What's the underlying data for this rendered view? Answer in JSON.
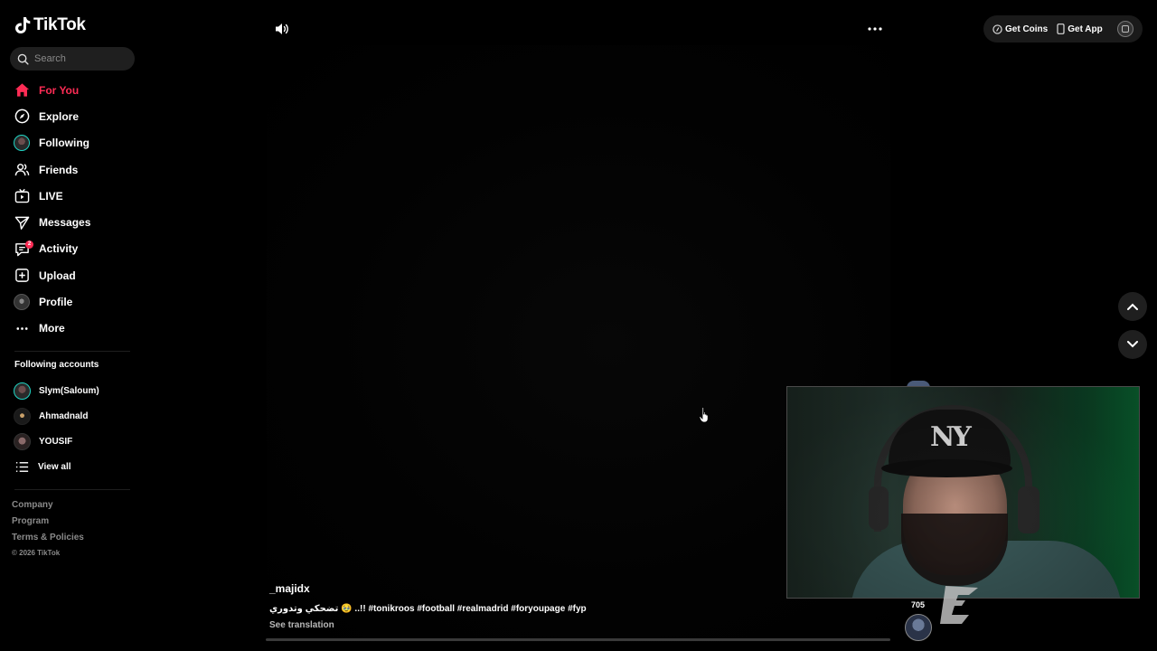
{
  "app": {
    "logo_text": "TikTok"
  },
  "search": {
    "placeholder": "Search"
  },
  "sidebar": {
    "items": [
      {
        "label": "For You",
        "icon": "home-icon",
        "active": true
      },
      {
        "label": "Explore",
        "icon": "compass-icon"
      },
      {
        "label": "Following",
        "icon": "following-avatar-icon"
      },
      {
        "label": "Friends",
        "icon": "friends-icon"
      },
      {
        "label": "LIVE",
        "icon": "live-icon"
      },
      {
        "label": "Messages",
        "icon": "messages-icon"
      },
      {
        "label": "Activity",
        "icon": "activity-icon",
        "badge": "2"
      },
      {
        "label": "Upload",
        "icon": "upload-icon"
      },
      {
        "label": "Profile",
        "icon": "profile-avatar-icon"
      },
      {
        "label": "More",
        "icon": "more-icon"
      }
    ],
    "following_title": "Following accounts",
    "following_accounts": [
      {
        "name": "Slym(Saloum)"
      },
      {
        "name": "Ahmadnald"
      },
      {
        "name": "YOUSIF"
      }
    ],
    "view_all": "View all",
    "footer": {
      "links": [
        "Company",
        "Program",
        "Terms & Policies"
      ],
      "copyright": "© 2026 TikTok"
    }
  },
  "topbar": {
    "get_coins": "Get Coins",
    "get_app": "Get App"
  },
  "video": {
    "author": "_majidx",
    "caption_prefix": "تضحكي وتدوري 🥹 ..!!",
    "hashtags": [
      "#tonikroos",
      "#football",
      "#realmadrid",
      "#foryoupage",
      "#fyp"
    ],
    "see_translation": "See translation",
    "like_count": "705"
  },
  "colors": {
    "accent": "#fe2c55",
    "background": "#000000",
    "following_ring": "#20d5c4"
  }
}
